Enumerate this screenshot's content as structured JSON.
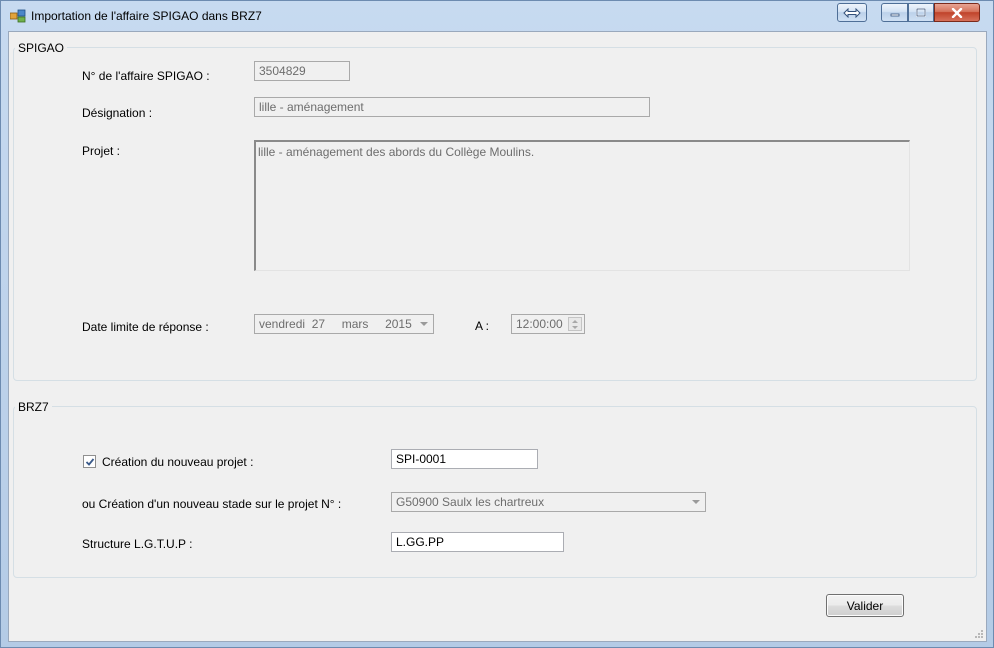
{
  "window": {
    "title": "Importation de l'affaire SPIGAO dans BRZ7"
  },
  "spigao": {
    "group_title": "SPIGAO",
    "affaire_label": "N° de l'affaire SPIGAO :",
    "affaire_value": "3504829",
    "designation_label": "Désignation :",
    "designation_value": "lille - aménagement",
    "projet_label": "Projet :",
    "projet_value": "lille - aménagement des abords du Collège Moulins.",
    "date_label": "Date limite de réponse :",
    "date_weekday": "vendredi",
    "date_day": "27",
    "date_month": "mars",
    "date_year": "2015",
    "time_label": "A :",
    "time_value": "12:00:00"
  },
  "brz7": {
    "group_title": "BRZ7",
    "creation_label": "Création du nouveau projet  :",
    "creation_checked": true,
    "creation_value": "SPI-0001",
    "stade_label": "ou Création d'un nouveau stade sur le projet N° :",
    "stade_value": "G50900 Saulx les chartreux",
    "structure_label": "Structure L.G.T.U.P  :",
    "structure_value": "L.GG.PP"
  },
  "actions": {
    "validate_label": "Valider"
  },
  "icons": {
    "app": "app-icon",
    "resize": "resize-arrows-icon",
    "minimize": "minimize-icon",
    "maximize": "maximize-icon",
    "close": "close-icon"
  }
}
